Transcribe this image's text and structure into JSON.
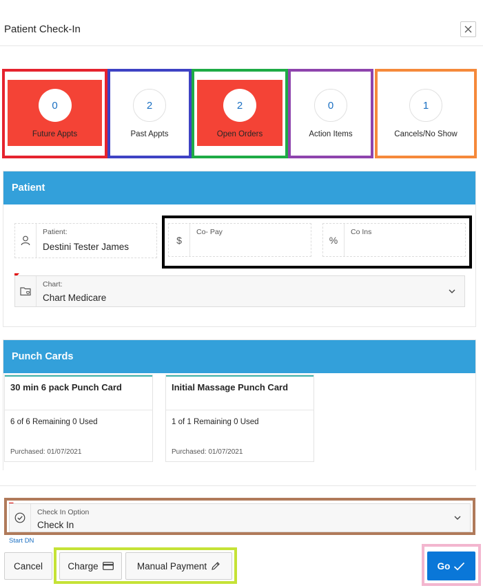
{
  "dialog": {
    "title": "Patient Check-In",
    "close_icon": "close-icon"
  },
  "stats": [
    {
      "value": "0",
      "label": "Future Appts",
      "frame_color": "#e5232e",
      "filled": true
    },
    {
      "value": "2",
      "label": "Past Appts",
      "frame_color": "#3e42c4",
      "filled": false
    },
    {
      "value": "2",
      "label": "Open Orders",
      "frame_color": "#1eab45",
      "filled": true
    },
    {
      "value": "0",
      "label": "Action Items",
      "frame_color": "#8e44ad",
      "filled": false
    },
    {
      "value": "1",
      "label": "Cancels/No Show",
      "frame_color": "#f5893a",
      "filled": false
    }
  ],
  "patient_region": {
    "title": "Patient",
    "patient_label": "Patient:",
    "patient_value": "Destini Tester James",
    "copay_label": "Co- Pay",
    "copay_icon_glyph": "$",
    "coins_label": "Co Ins",
    "coins_icon_glyph": "%",
    "chart_label": "Chart:",
    "chart_value": "Chart Medicare"
  },
  "punch_region": {
    "title": "Punch Cards",
    "cards": [
      {
        "title": "30 min 6 pack Punch Card",
        "remaining": "6 of 6 Remaining 0 Used",
        "purchased": "Purchased: 01/07/2021"
      },
      {
        "title": "Initial Massage Punch Card",
        "remaining": "1 of 1 Remaining 0 Used",
        "purchased": "Purchased: 01/07/2021"
      }
    ]
  },
  "checkin": {
    "label": "Check In Option",
    "value": "Check In",
    "start_link": "Start DN"
  },
  "buttons": {
    "cancel": "Cancel",
    "charge": "Charge",
    "manual_payment": "Manual Payment",
    "go": "Go"
  },
  "colors": {
    "accent_blue": "#33a0da",
    "go_blue": "#0a77d8",
    "tile_red": "#f44336",
    "highlight_black": "#000000",
    "highlight_brown": "#b07a5a",
    "highlight_lime": "#c5e236",
    "highlight_pink": "#f3b6cf"
  }
}
